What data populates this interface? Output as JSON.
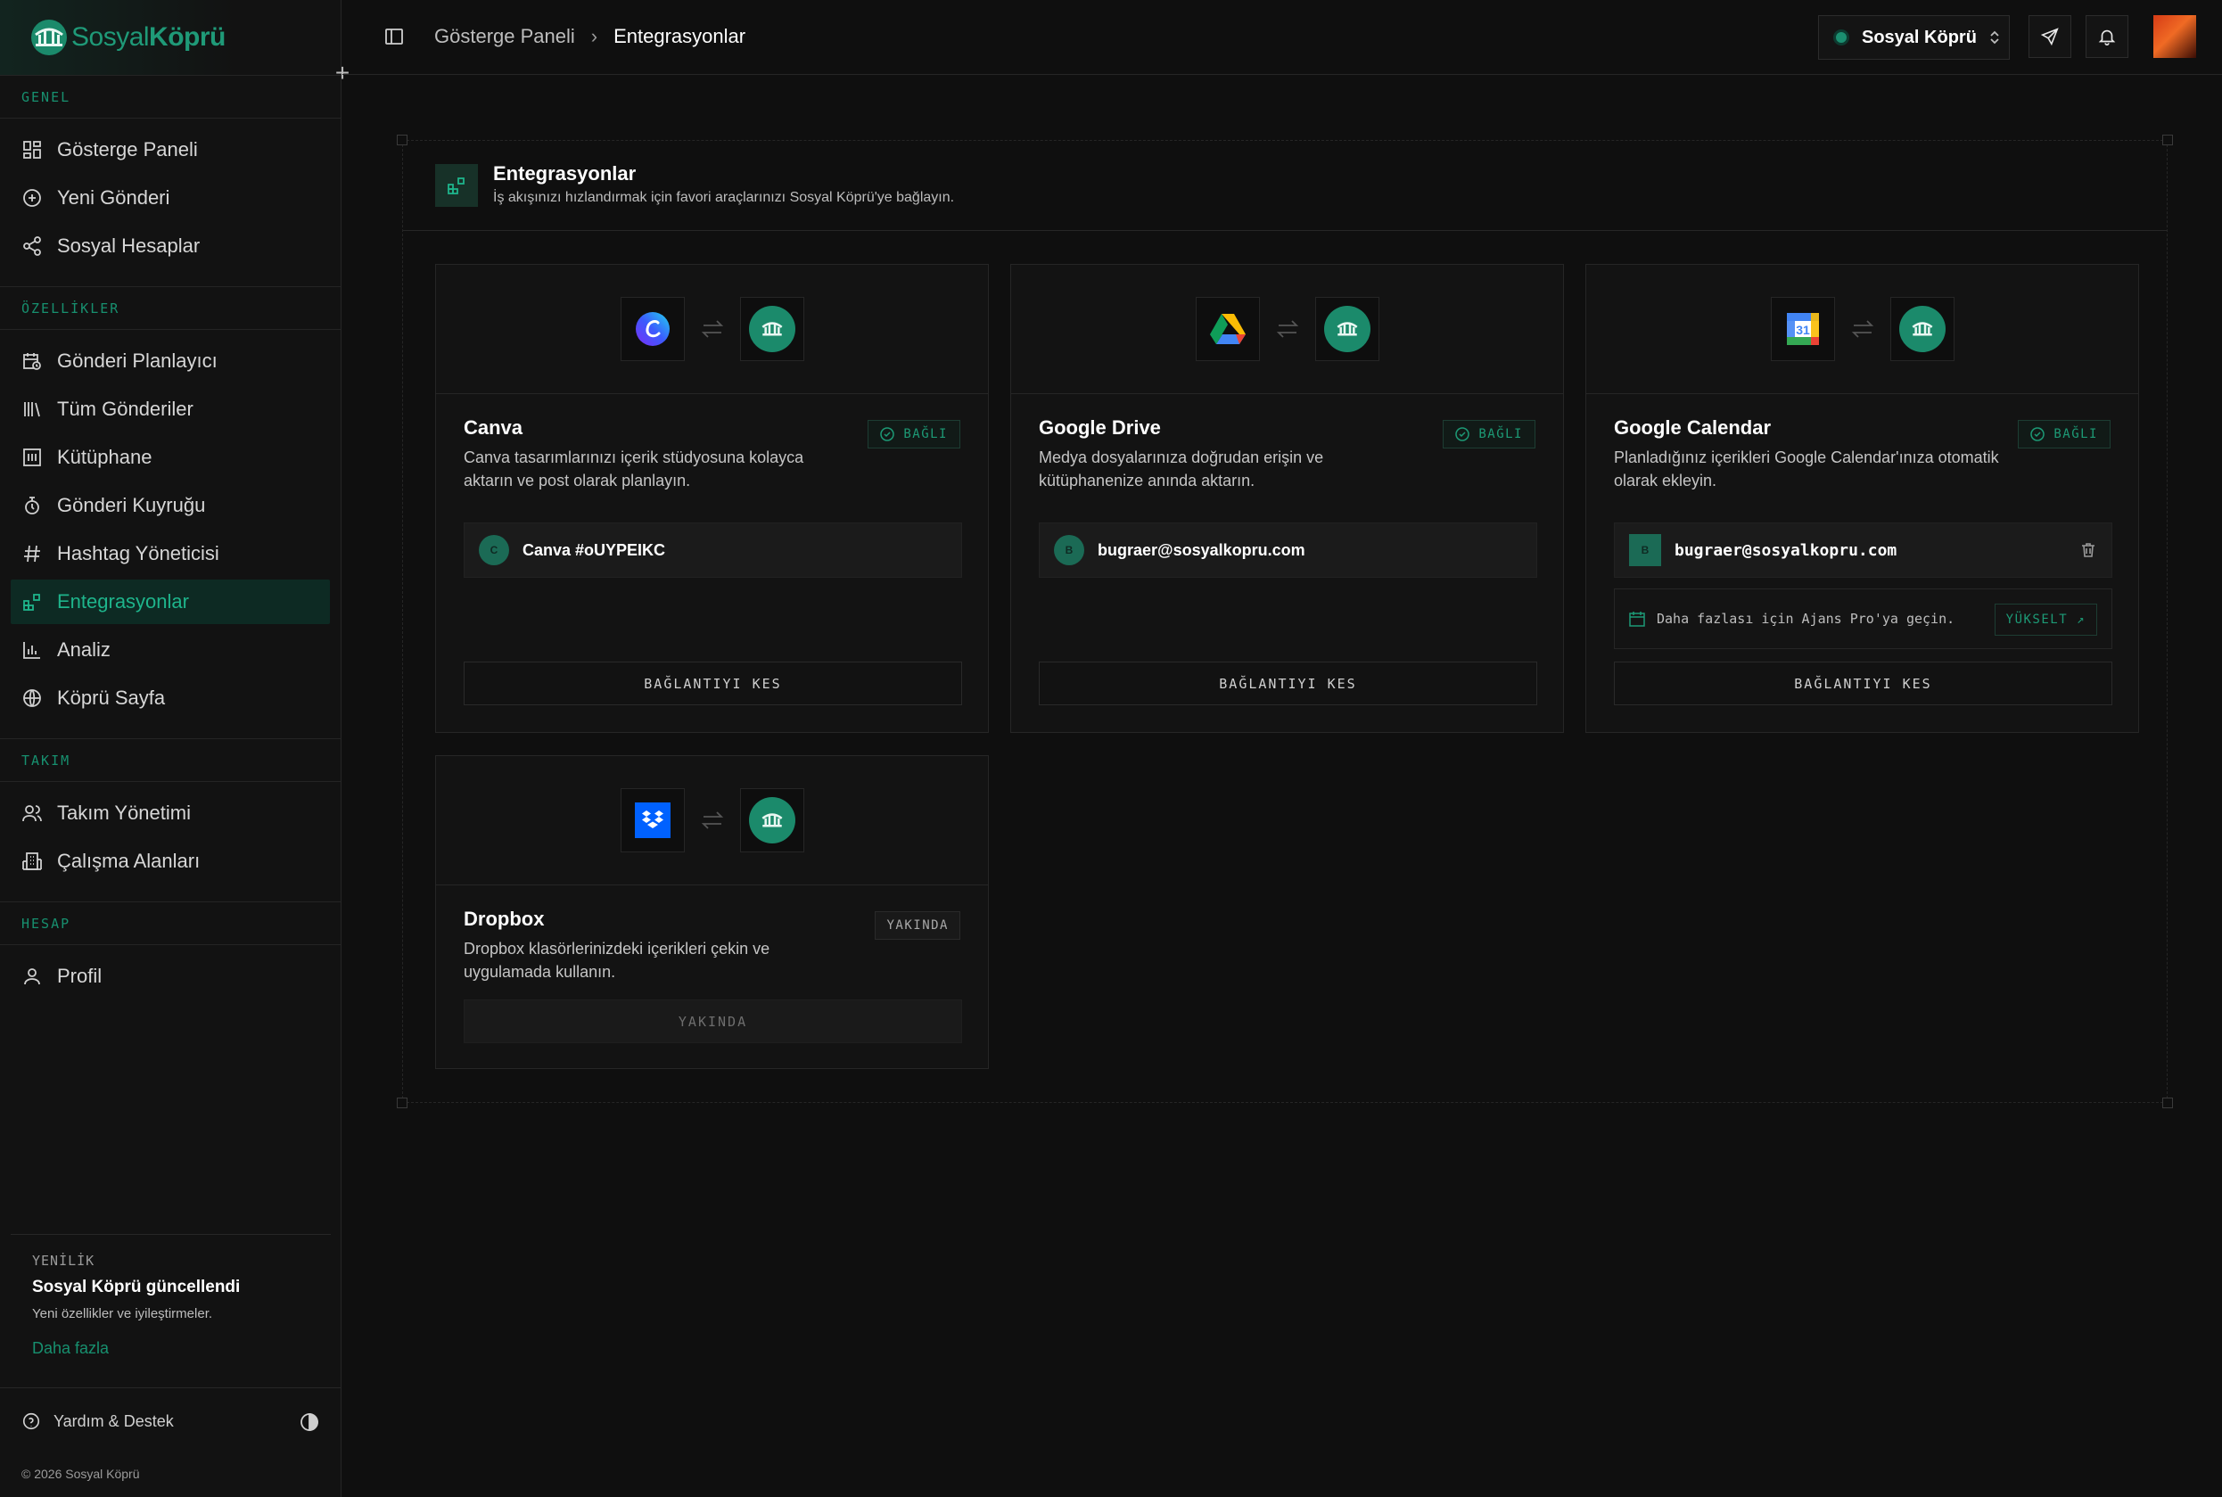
{
  "brand": {
    "name_part1": "Sosyal",
    "name_part2": "Köprü"
  },
  "sidebar": {
    "sections": [
      {
        "title": "GENEL",
        "items": [
          {
            "label": "Gösterge Paneli",
            "icon": "dashboard-icon"
          },
          {
            "label": "Yeni Gönderi",
            "icon": "plus-circle-icon"
          },
          {
            "label": "Sosyal Hesaplar",
            "icon": "share-icon"
          }
        ]
      },
      {
        "title": "ÖZELLİKLER",
        "items": [
          {
            "label": "Gönderi Planlayıcı",
            "icon": "calendar-clock-icon"
          },
          {
            "label": "Tüm Gönderiler",
            "icon": "library-icon"
          },
          {
            "label": "Kütüphane",
            "icon": "gallery-icon"
          },
          {
            "label": "Gönderi Kuyruğu",
            "icon": "queue-icon"
          },
          {
            "label": "Hashtag Yöneticisi",
            "icon": "hash-icon"
          },
          {
            "label": "Entegrasyonlar",
            "icon": "blocks-icon",
            "active": true
          },
          {
            "label": "Analiz",
            "icon": "bar-chart-icon"
          },
          {
            "label": "Köprü Sayfa",
            "icon": "globe-icon"
          }
        ]
      },
      {
        "title": "TAKIM",
        "items": [
          {
            "label": "Takım Yönetimi",
            "icon": "users-icon"
          },
          {
            "label": "Çalışma Alanları",
            "icon": "building-icon"
          }
        ]
      },
      {
        "title": "HESAP",
        "items": [
          {
            "label": "Profil",
            "icon": "user-icon"
          }
        ]
      }
    ],
    "news": {
      "tag": "YENİLİK",
      "title": "Sosyal Köprü güncellendi",
      "subtitle": "Yeni özellikler ve iyileştirmeler.",
      "link": "Daha fazla"
    },
    "help_label": "Yardım & Destek",
    "copyright": "© 2026 Sosyal Köprü"
  },
  "topbar": {
    "breadcrumb": {
      "home": "Gösterge Paneli",
      "separator": "›",
      "current": "Entegrasyonlar"
    },
    "workspace": "Sosyal Köprü"
  },
  "page": {
    "title": "Entegrasyonlar",
    "subtitle": "İş akışınızı hızlandırmak için favori araçlarınızı Sosyal Köprü'ye bağlayın."
  },
  "integrations": {
    "canva": {
      "name": "Canva",
      "description": "Canva tasarımlarınızı içerik stüdyosuna kolayca aktarın ve post olarak planlayın.",
      "status": "BAĞLI",
      "account_initial": "C",
      "account": "Canva #oUYPEIKC",
      "action": "BAĞLANTIYI KES"
    },
    "gdrive": {
      "name": "Google Drive",
      "description": "Medya dosyalarınıza doğrudan erişin ve kütüphanenize anında aktarın.",
      "status": "BAĞLI",
      "account_initial": "B",
      "account": "bugraer@sosyalkopru.com",
      "action": "BAĞLANTIYI KES"
    },
    "gcal": {
      "name": "Google Calendar",
      "description": "Planladığınız içerikleri Google Calendar'ınıza otomatik olarak ekleyin.",
      "status": "BAĞLI",
      "account_initial": "B",
      "account": "bugraer@sosyalkopru.com",
      "upgrade_text": "Daha fazlası için Ajans Pro'ya geçin.",
      "upgrade_button": "YÜKSELT ↗",
      "calendar_day": "31",
      "action": "BAĞLANTIYI KES"
    },
    "dropbox": {
      "name": "Dropbox",
      "description": "Dropbox klasörlerinizdeki içerikleri çekin ve uygulamada kullanın.",
      "status": "YAKINDA",
      "action": "YAKINDA"
    }
  },
  "colors": {
    "accent": "#1b8a6b",
    "accent_text": "#1d9a76",
    "background": "#0f0f0f",
    "active_bg": "#0d2a23"
  }
}
